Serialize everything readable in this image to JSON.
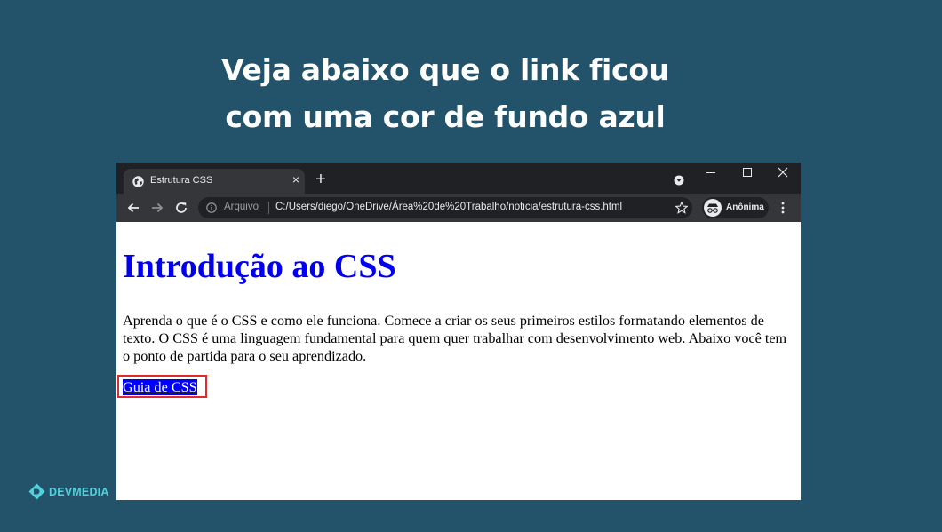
{
  "slide": {
    "headline_line1": "Veja abaixo que o link ficou",
    "headline_line2": "com uma cor de fundo azul"
  },
  "browser": {
    "tab_title": "Estrutura CSS",
    "tab_close": "×",
    "new_tab": "+",
    "address_prefix": "Arquivo",
    "url": "C:/Users/diego/OneDrive/Área%20de%20Trabalho/noticia/estrutura-css.html",
    "profile_label": "Anônima"
  },
  "page": {
    "heading": "Introdução ao CSS",
    "paragraph": "Aprenda o que é o CSS e como ele funciona. Comece a criar os seus primeiros estilos formatando elementos de texto. O CSS é uma linguagem fundamental para quem quer trabalhar com desenvolvimento web. Abaixo você tem o ponto de partida para o seu aprendizado.",
    "link_text": "Guia de CSS"
  },
  "brand": {
    "logo_text": "DEVMEDIA"
  },
  "colors": {
    "background": "#22536a",
    "link_background": "#0000ff",
    "heading_color": "#0000ee",
    "highlight_border": "#e32a2a",
    "logo_accent": "#4fd2db"
  }
}
